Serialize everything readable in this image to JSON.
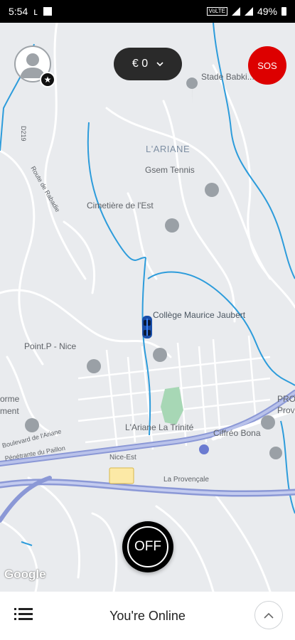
{
  "status_bar": {
    "time": "5:54",
    "battery": "49%",
    "network_badge": "VoLTE"
  },
  "header": {
    "earnings": "€ 0",
    "sos_label": "SOS"
  },
  "map": {
    "labels": {
      "stade": "Stade Babki...lube",
      "ariane": "L'ARIANE",
      "gsem": "Gsem Tennis",
      "cimetiere": "Cimetière de l'Est",
      "college": "Collège Maurice Jaubert",
      "pointp": "Point.P - Nice",
      "route_rabadie": "Route de Rabadie",
      "d219": "D219",
      "ariane_trinite": "L'Ariane La Trinité",
      "ciffreo": "Ciffréo Bona",
      "nice_est": "Nice-Est",
      "prov": "PROV",
      "prov2": "Prov",
      "orme": "orme",
      "ment": "ment",
      "boulevard": "Boulevard de l'Ariane",
      "provencale": "La Provençale",
      "rrsa": "Pénétrante du Paillon"
    },
    "attribution": "Google"
  },
  "driver_state": {
    "toggle_label": "OFF",
    "status_text": "You're Online"
  }
}
